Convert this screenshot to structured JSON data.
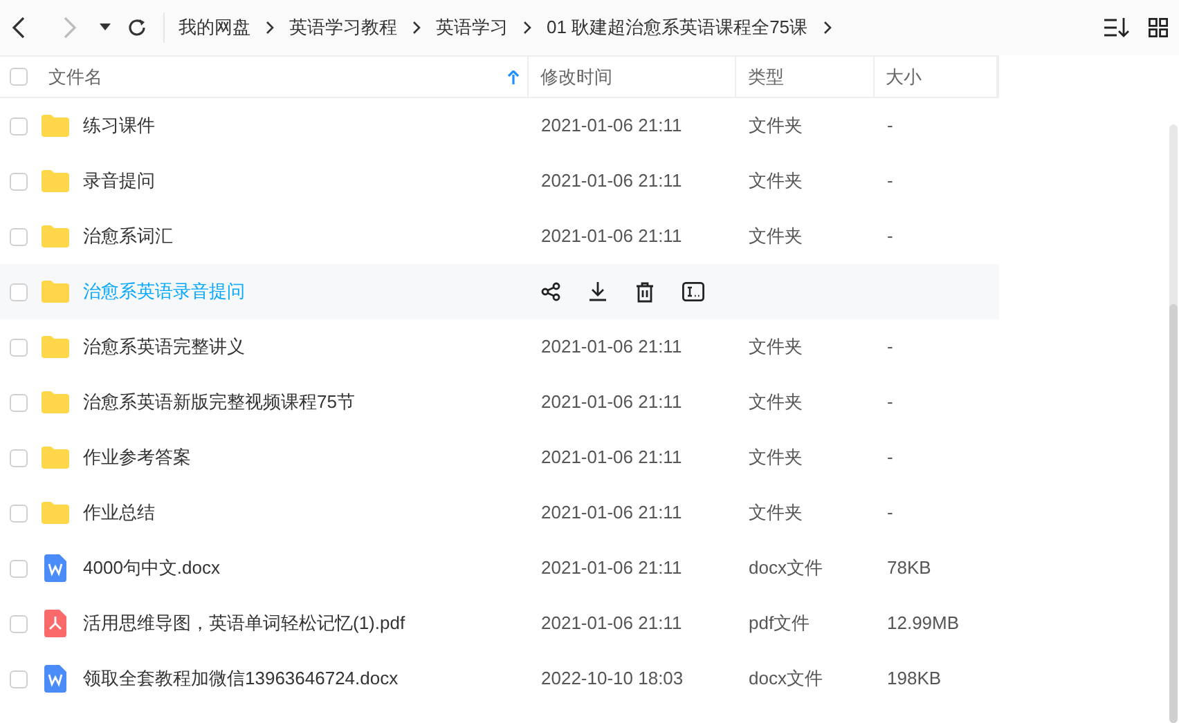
{
  "breadcrumb": [
    "我的网盘",
    "英语学习教程",
    "英语学习",
    "01 耿建超治愈系英语课程全75课"
  ],
  "select_all": {
    "checked": false
  },
  "columns": [
    {
      "label": "文件名",
      "sorted": true
    },
    {
      "label": "修改时间",
      "sorted": false
    },
    {
      "label": "类型",
      "sorted": false
    },
    {
      "label": "大小",
      "sorted": false
    }
  ],
  "rows": [
    {
      "kind": "folder",
      "name": "练习课件",
      "modified": "2021-01-06 21:11",
      "type": "文件夹",
      "size": "-",
      "hovered": false,
      "checked": false
    },
    {
      "kind": "folder",
      "name": "录音提问",
      "modified": "2021-01-06 21:11",
      "type": "文件夹",
      "size": "-",
      "hovered": false,
      "checked": false
    },
    {
      "kind": "folder",
      "name": "治愈系词汇",
      "modified": "2021-01-06 21:11",
      "type": "文件夹",
      "size": "-",
      "hovered": false,
      "checked": false
    },
    {
      "kind": "folder",
      "name": "治愈系英语录音提问",
      "hovered": true,
      "checked": false
    },
    {
      "kind": "folder",
      "name": "治愈系英语完整讲义",
      "modified": "2021-01-06 21:11",
      "type": "文件夹",
      "size": "-",
      "hovered": false,
      "checked": false
    },
    {
      "kind": "folder",
      "name": "治愈系英语新版完整视频课程75节",
      "modified": "2021-01-06 21:11",
      "type": "文件夹",
      "size": "-",
      "hovered": false,
      "checked": false
    },
    {
      "kind": "folder",
      "name": "作业参考答案",
      "modified": "2021-01-06 21:11",
      "type": "文件夹",
      "size": "-",
      "hovered": false,
      "checked": false
    },
    {
      "kind": "folder",
      "name": "作业总结",
      "modified": "2021-01-06 21:11",
      "type": "文件夹",
      "size": "-",
      "hovered": false,
      "checked": false
    },
    {
      "kind": "word",
      "name": "4000句中文.docx",
      "modified": "2021-01-06 21:11",
      "type": "docx文件",
      "size": "78KB",
      "hovered": false,
      "checked": false
    },
    {
      "kind": "pdf",
      "name": "活用思维导图，英语单词轻松记忆(1).pdf",
      "modified": "2021-01-06 21:11",
      "type": "pdf文件",
      "size": "12.99MB",
      "hovered": false,
      "checked": false
    },
    {
      "kind": "word",
      "name": "领取全套教程加微信13963646724.docx",
      "modified": "2022-10-10 18:03",
      "type": "docx文件",
      "size": "198KB",
      "hovered": false,
      "checked": false
    }
  ]
}
